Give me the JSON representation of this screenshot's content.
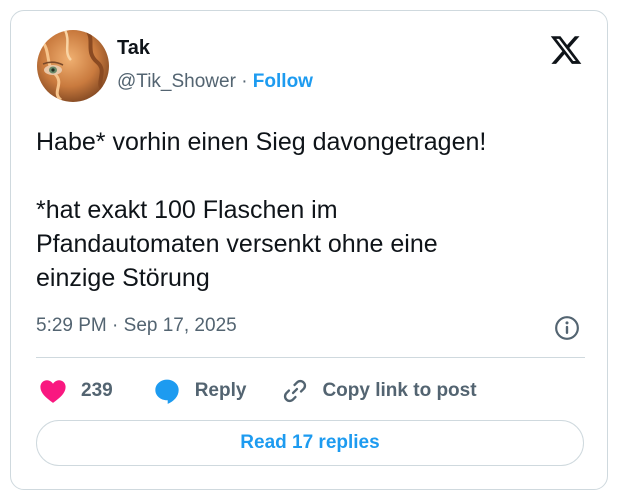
{
  "author": {
    "name": "Tak",
    "handle": "@Tik_Shower",
    "separator": "·",
    "follow_label": "Follow"
  },
  "tweet": {
    "lines": [
      "Habe* vorhin einen Sieg davongetragen!",
      "*hat exakt 100 Flaschen im",
      "Pfandautomaten versenkt ohne eine",
      "einzige Störung"
    ],
    "time": "5:29 PM",
    "separator": "·",
    "date": "Sep 17, 2025"
  },
  "actions": {
    "like_count": "239",
    "reply_label": "Reply",
    "copy_label": "Copy link to post",
    "read_replies_label": "Read 17 replies"
  },
  "icons": {
    "logo": "x-logo-icon",
    "info": "info-icon",
    "like": "heart-icon",
    "reply": "speech-bubble-icon",
    "copy": "link-icon"
  },
  "colors": {
    "accent": "#1d9bf0",
    "heart": "#f91880",
    "text": "#0f1419",
    "muted": "#536471",
    "border": "#cfd9de"
  }
}
